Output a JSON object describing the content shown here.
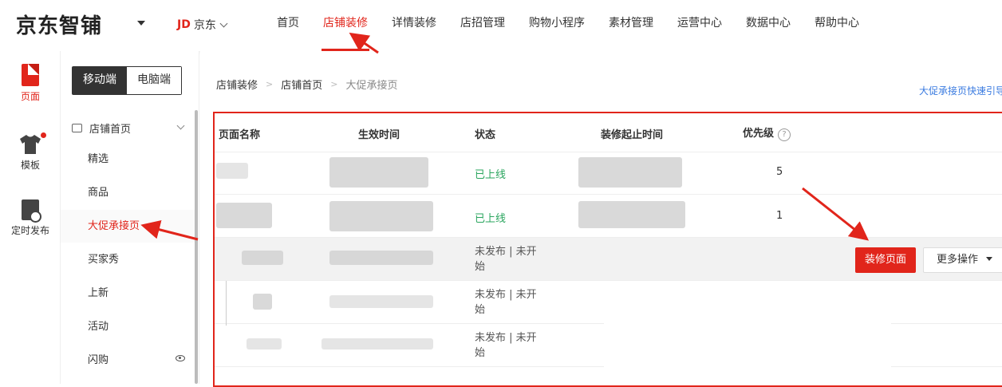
{
  "header": {
    "brand": "京东智铺",
    "store_switch": {
      "logo": "JD",
      "label": "京东"
    },
    "nav": [
      {
        "label": "首页",
        "active": false
      },
      {
        "label": "店铺装修",
        "active": true
      },
      {
        "label": "详情装修",
        "active": false
      },
      {
        "label": "店招管理",
        "active": false
      },
      {
        "label": "购物小程序",
        "active": false
      },
      {
        "label": "素材管理",
        "active": false
      },
      {
        "label": "运营中心",
        "active": false
      },
      {
        "label": "数据中心",
        "active": false
      },
      {
        "label": "帮助中心",
        "active": false
      }
    ]
  },
  "rail": [
    {
      "label": "页面",
      "icon": "page-icon",
      "active": true
    },
    {
      "label": "模板",
      "icon": "tshirt-icon",
      "badge": true
    },
    {
      "label": "定时发布",
      "icon": "schedule-icon"
    }
  ],
  "sidebar": {
    "tabs": [
      {
        "label": "移动端",
        "active": true
      },
      {
        "label": "电脑端",
        "active": false
      }
    ],
    "group": "店铺首页",
    "items": [
      {
        "label": "精选"
      },
      {
        "label": "商品"
      },
      {
        "label": "大促承接页",
        "active": true
      },
      {
        "label": "买家秀"
      },
      {
        "label": "上新"
      },
      {
        "label": "活动"
      },
      {
        "label": "闪购",
        "eye": true
      }
    ]
  },
  "breadcrumb": [
    "店铺装修",
    "店铺首页",
    "大促承接页"
  ],
  "guide_link": "大促承接页快速引导",
  "table": {
    "columns": [
      "页面名称",
      "生效时间",
      "状态",
      "装修起止时间",
      "优先级"
    ],
    "rows": [
      {
        "status": "已上线",
        "priority": "5"
      },
      {
        "status": "已上线",
        "priority": "1"
      },
      {
        "status": "未发布 | 未开始",
        "actions": {
          "primary": "装修页面",
          "more": "更多操作"
        }
      },
      {
        "status": "未发布 | 未开始"
      },
      {
        "status": "未发布 | 未开始"
      }
    ]
  },
  "colors": {
    "accent": "#e1251b",
    "online": "#2aa55e",
    "link": "#3a7be0"
  }
}
